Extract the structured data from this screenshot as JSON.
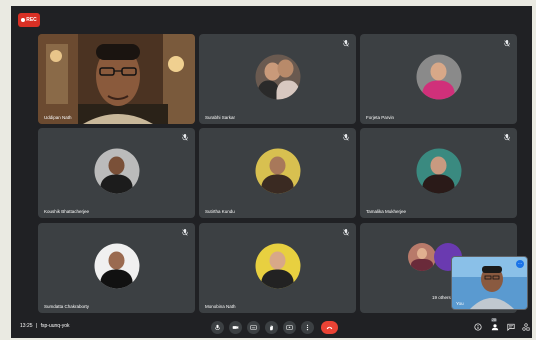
{
  "recording": {
    "label": "REC",
    "color": "#d93025"
  },
  "participants": [
    {
      "name": "Uddipan Nath",
      "video": true
    },
    {
      "name": "Surabhi Sarkar",
      "video": false
    },
    {
      "name": "Forjeta Parvin",
      "video": false
    },
    {
      "name": "Koushik Bhattacherjee",
      "video": false
    },
    {
      "name": "Sutirtha Kundu",
      "video": false
    },
    {
      "name": "Tamalika Mukherjee",
      "video": false
    },
    {
      "name": "Sumdatta Chakraborty",
      "video": false
    },
    {
      "name": "Monobina Nath",
      "video": false
    }
  ],
  "others": {
    "label": "19 others"
  },
  "self_view": {
    "label": "You"
  },
  "meeting": {
    "time": "13:25",
    "separator": "|",
    "code": "fsp-uunq-yok"
  },
  "controls": [
    {
      "icon": "microphone-icon"
    },
    {
      "icon": "camera-icon"
    },
    {
      "icon": "captions-icon"
    },
    {
      "icon": "raise-hand-icon"
    },
    {
      "icon": "present-screen-icon"
    },
    {
      "icon": "more-options-icon"
    },
    {
      "icon": "end-call-icon",
      "color": "#ea4335"
    }
  ],
  "side_controls": {
    "people_count": "28"
  },
  "colors": {
    "background": "#202124",
    "tile": "#3c4043",
    "end_call": "#ea4335"
  }
}
